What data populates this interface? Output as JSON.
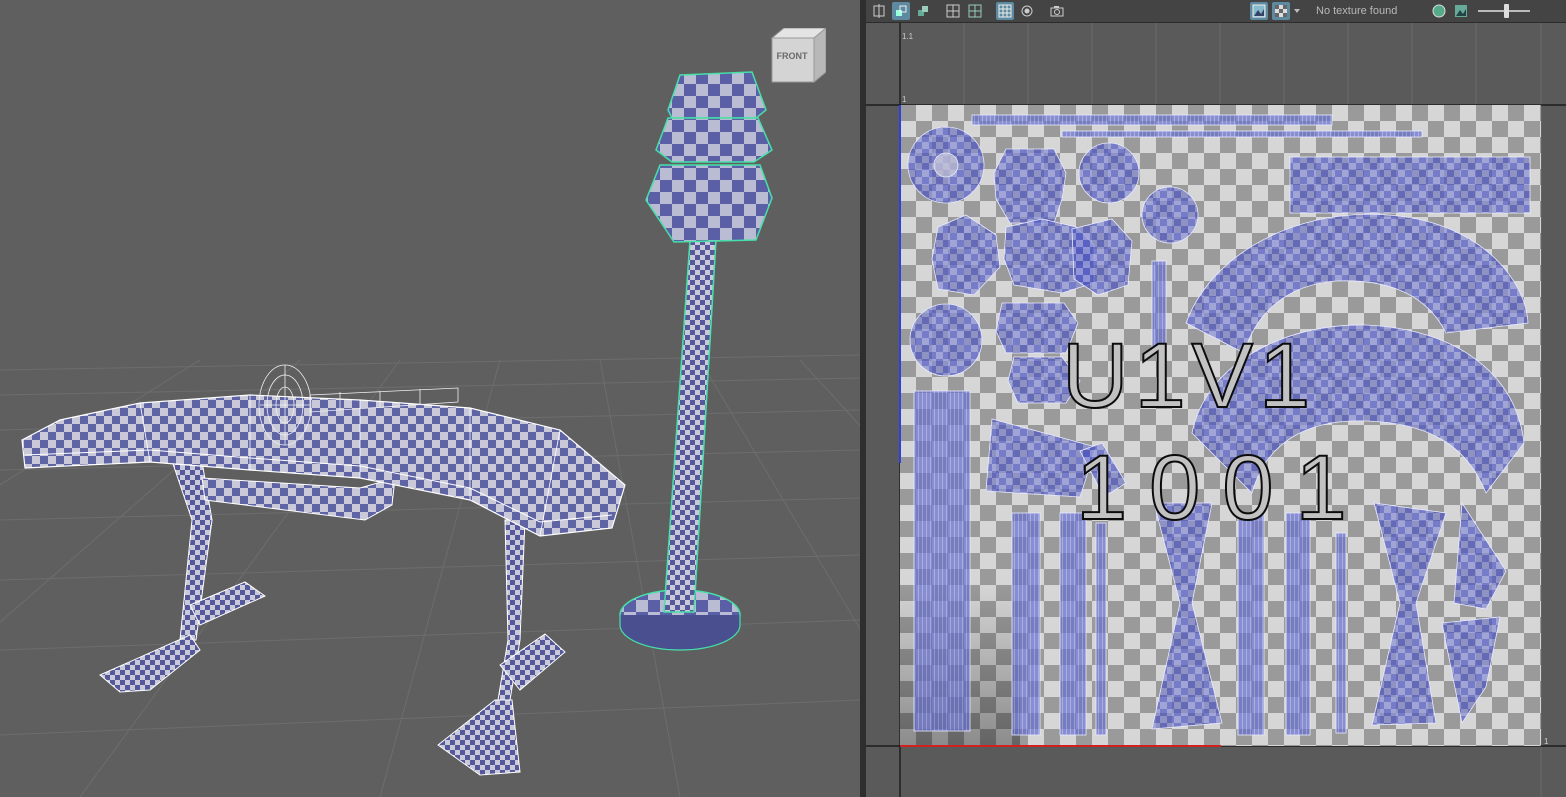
{
  "viewport": {
    "view_cube_label": "FRONT"
  },
  "uv_editor": {
    "texture_status": "No texture found",
    "udim_label_top": "U1V1",
    "udim_label_bottom": "1001",
    "corner_top_left": "1.1",
    "corner_v_one": "1",
    "corner_bottom_right": "1"
  },
  "toolbar": {
    "icons": [
      {
        "name": "uv-frame-icon",
        "active": false
      },
      {
        "name": "uv-shell-icon",
        "active": true
      },
      {
        "name": "uv-shade-icon",
        "active": false
      },
      {
        "name": "grid-icon",
        "active": false
      },
      {
        "name": "pixel-snap-icon",
        "active": false
      },
      {
        "name": "checker-grid-icon",
        "active": true
      },
      {
        "name": "dim-image-icon",
        "active": false
      },
      {
        "name": "camera-icon",
        "active": false
      }
    ],
    "image_display_active": true,
    "checker_display_active": true,
    "exposure_fraction": 0.55
  },
  "colors": {
    "viewport_bg": "#5f5f5f",
    "uv_bg": "#5a5a5a",
    "shell_blue": "#3b46c8",
    "selection_green": "#46e0a8"
  }
}
